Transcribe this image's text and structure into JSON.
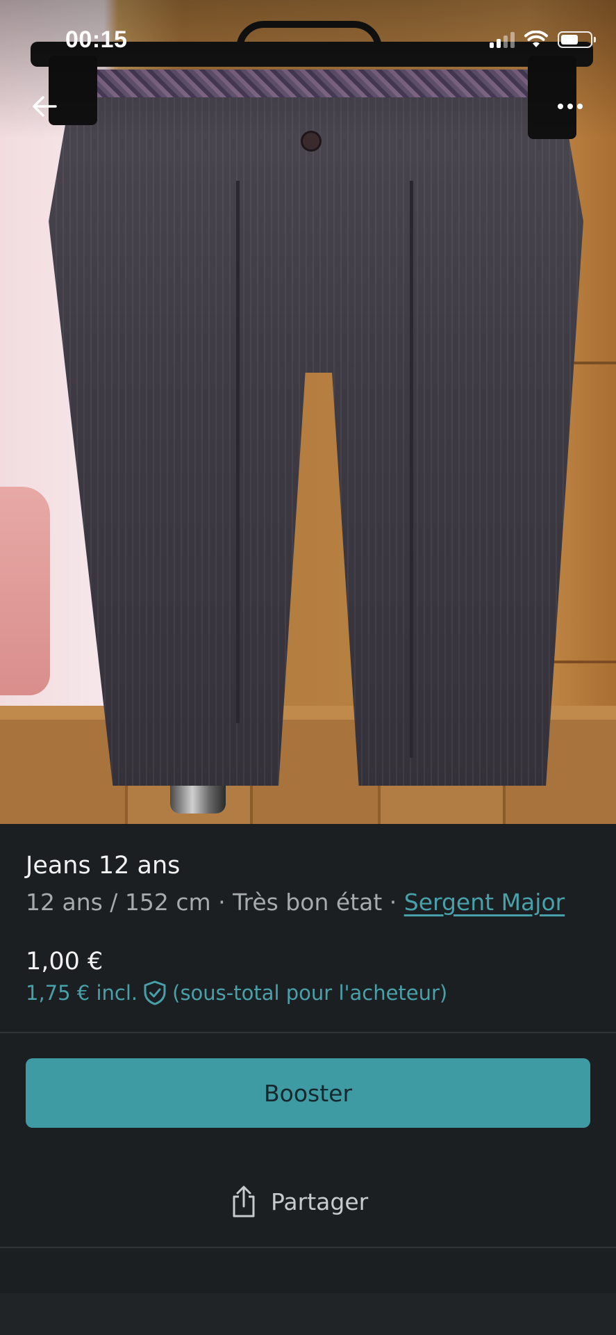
{
  "status_bar": {
    "time": "00:15"
  },
  "icons": {
    "back": "arrow-left-icon",
    "more": "more-horizontal-icon",
    "shield": "shield-check-icon",
    "share": "share-icon"
  },
  "item": {
    "title": "Jeans 12 ans",
    "size": "12 ans / 152 cm",
    "separator": " · ",
    "condition": "Très bon état",
    "brand": "Sergent Major",
    "price": "1,00 €",
    "price_incl_prefix": "1,75 € incl.",
    "price_incl_suffix": "(sous-total pour l'acheteur)"
  },
  "actions": {
    "booster_label": "Booster",
    "share_label": "Partager"
  },
  "colors": {
    "accent": "#48a1aa",
    "button": "#3e9aa3",
    "background": "#1b1f22"
  }
}
